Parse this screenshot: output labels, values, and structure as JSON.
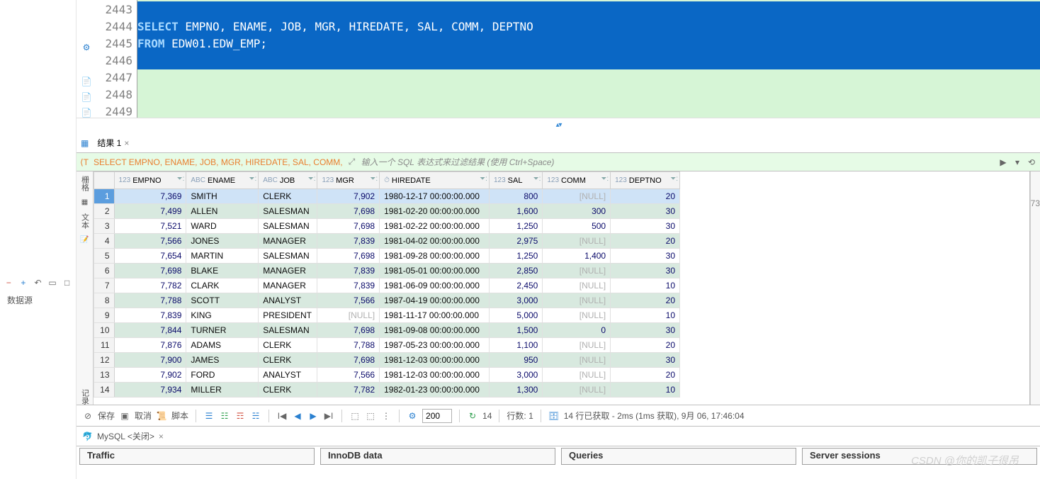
{
  "editor": {
    "lines": [
      "2443",
      "2444",
      "2445",
      "2446",
      "2447",
      "2448",
      "2449"
    ],
    "sql_kw1": "SELECT",
    "sql_rest1": " EMPNO, ENAME, JOB, MGR, HIREDATE, SAL, COMM, DEPTNO",
    "sql_kw2": "FROM",
    "sql_rest2": " EDW01.EDW_EMP;"
  },
  "tab": {
    "label": "结果 1"
  },
  "filter": {
    "sql": "SELECT EMPNO, ENAME, JOB, MGR, HIREDATE, SAL, COMM,",
    "hint": "输入一个 SQL 表达式来过滤结果 (使用 Ctrl+Space)"
  },
  "sidebar_labels": {
    "grid": "栅格",
    "text": "文本",
    "record": "记录"
  },
  "columns": [
    {
      "name": "EMPNO",
      "prefix": "123",
      "w": 100
    },
    {
      "name": "ENAME",
      "prefix": "ABC",
      "w": 100
    },
    {
      "name": "JOB",
      "prefix": "ABC",
      "w": 76
    },
    {
      "name": "MGR",
      "prefix": "123",
      "w": 86
    },
    {
      "name": "HIREDATE",
      "prefix": "⏱",
      "w": 152
    },
    {
      "name": "SAL",
      "prefix": "123",
      "w": 74
    },
    {
      "name": "COMM",
      "prefix": "123",
      "w": 94
    },
    {
      "name": "DEPTNO",
      "prefix": "123",
      "w": 96
    }
  ],
  "rows": [
    {
      "n": 1,
      "EMPNO": "7,369",
      "ENAME": "SMITH",
      "JOB": "CLERK",
      "MGR": "7,902",
      "HIREDATE": "1980-12-17 00:00:00.000",
      "SAL": "800",
      "COMM": null,
      "DEPTNO": "20"
    },
    {
      "n": 2,
      "EMPNO": "7,499",
      "ENAME": "ALLEN",
      "JOB": "SALESMAN",
      "MGR": "7,698",
      "HIREDATE": "1981-02-20 00:00:00.000",
      "SAL": "1,600",
      "COMM": "300",
      "DEPTNO": "30"
    },
    {
      "n": 3,
      "EMPNO": "7,521",
      "ENAME": "WARD",
      "JOB": "SALESMAN",
      "MGR": "7,698",
      "HIREDATE": "1981-02-22 00:00:00.000",
      "SAL": "1,250",
      "COMM": "500",
      "DEPTNO": "30"
    },
    {
      "n": 4,
      "EMPNO": "7,566",
      "ENAME": "JONES",
      "JOB": "MANAGER",
      "MGR": "7,839",
      "HIREDATE": "1981-04-02 00:00:00.000",
      "SAL": "2,975",
      "COMM": null,
      "DEPTNO": "20"
    },
    {
      "n": 5,
      "EMPNO": "7,654",
      "ENAME": "MARTIN",
      "JOB": "SALESMAN",
      "MGR": "7,698",
      "HIREDATE": "1981-09-28 00:00:00.000",
      "SAL": "1,250",
      "COMM": "1,400",
      "DEPTNO": "30"
    },
    {
      "n": 6,
      "EMPNO": "7,698",
      "ENAME": "BLAKE",
      "JOB": "MANAGER",
      "MGR": "7,839",
      "HIREDATE": "1981-05-01 00:00:00.000",
      "SAL": "2,850",
      "COMM": null,
      "DEPTNO": "30"
    },
    {
      "n": 7,
      "EMPNO": "7,782",
      "ENAME": "CLARK",
      "JOB": "MANAGER",
      "MGR": "7,839",
      "HIREDATE": "1981-06-09 00:00:00.000",
      "SAL": "2,450",
      "COMM": null,
      "DEPTNO": "10"
    },
    {
      "n": 8,
      "EMPNO": "7,788",
      "ENAME": "SCOTT",
      "JOB": "ANALYST",
      "MGR": "7,566",
      "HIREDATE": "1987-04-19 00:00:00.000",
      "SAL": "3,000",
      "COMM": null,
      "DEPTNO": "20"
    },
    {
      "n": 9,
      "EMPNO": "7,839",
      "ENAME": "KING",
      "JOB": "PRESIDENT",
      "MGR": null,
      "HIREDATE": "1981-11-17 00:00:00.000",
      "SAL": "5,000",
      "COMM": null,
      "DEPTNO": "10"
    },
    {
      "n": 10,
      "EMPNO": "7,844",
      "ENAME": "TURNER",
      "JOB": "SALESMAN",
      "MGR": "7,698",
      "HIREDATE": "1981-09-08 00:00:00.000",
      "SAL": "1,500",
      "COMM": "0",
      "DEPTNO": "30"
    },
    {
      "n": 11,
      "EMPNO": "7,876",
      "ENAME": "ADAMS",
      "JOB": "CLERK",
      "MGR": "7,788",
      "HIREDATE": "1987-05-23 00:00:00.000",
      "SAL": "1,100",
      "COMM": null,
      "DEPTNO": "20"
    },
    {
      "n": 12,
      "EMPNO": "7,900",
      "ENAME": "JAMES",
      "JOB": "CLERK",
      "MGR": "7,698",
      "HIREDATE": "1981-12-03 00:00:00.000",
      "SAL": "950",
      "COMM": null,
      "DEPTNO": "30"
    },
    {
      "n": 13,
      "EMPNO": "7,902",
      "ENAME": "FORD",
      "JOB": "ANALYST",
      "MGR": "7,566",
      "HIREDATE": "1981-12-03 00:00:00.000",
      "SAL": "3,000",
      "COMM": null,
      "DEPTNO": "20"
    },
    {
      "n": 14,
      "EMPNO": "7,934",
      "ENAME": "MILLER",
      "JOB": "CLERK",
      "MGR": "7,782",
      "HIREDATE": "1982-01-23 00:00:00.000",
      "SAL": "1,300",
      "COMM": null,
      "DEPTNO": "10"
    }
  ],
  "status": {
    "save": "保存",
    "cancel": "取消",
    "script": "脚本",
    "page_size": "200",
    "row_count": "14",
    "rows_label": "行数: 1",
    "fetch_info": "14 行已获取 - 2ms (1ms 获取), 9月 06, 17:46:04"
  },
  "connection": {
    "label": "MySQL <关闭>"
  },
  "panels": {
    "traffic": "Traffic",
    "innodb": "InnoDB data",
    "queries": "Queries",
    "sessions": "Server sessions"
  },
  "left": {
    "datasource": "数据源"
  },
  "watermark": "CSDN @你的凯子很吊",
  "side_num": "73"
}
